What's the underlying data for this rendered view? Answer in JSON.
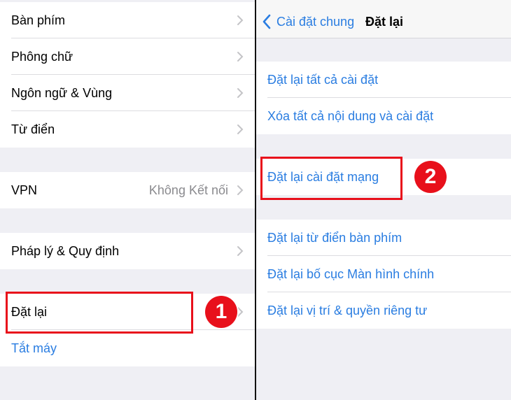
{
  "left_panel": {
    "group1": [
      "Bàn phím",
      "Phông chữ",
      "Ngôn ngữ & Vùng",
      "Từ điển"
    ],
    "vpn": {
      "label": "VPN",
      "value": "Không Kết nối"
    },
    "legal": "Pháp lý & Quy định",
    "reset": "Đặt lại",
    "shutdown": "Tắt máy"
  },
  "right_panel": {
    "back_label": "Cài đặt chung",
    "title": "Đặt lại",
    "group1": [
      "Đặt lại tất cả cài đặt",
      "Xóa tất cả nội dung và cài đặt"
    ],
    "group2": [
      "Đặt lại cài đặt mạng"
    ],
    "group3": [
      "Đặt lại từ điển bàn phím",
      "Đặt lại bố cục Màn hình chính",
      "Đặt lại vị trí & quyền riêng tư"
    ]
  },
  "annotations": {
    "step1": "1",
    "step2": "2"
  },
  "colors": {
    "link_blue": "#2a7de1",
    "highlight_red": "#e8101b",
    "background": "#efeff4"
  },
  "icons": {
    "row_chevron": "chevron-right-icon",
    "back": "chevron-left-icon"
  }
}
